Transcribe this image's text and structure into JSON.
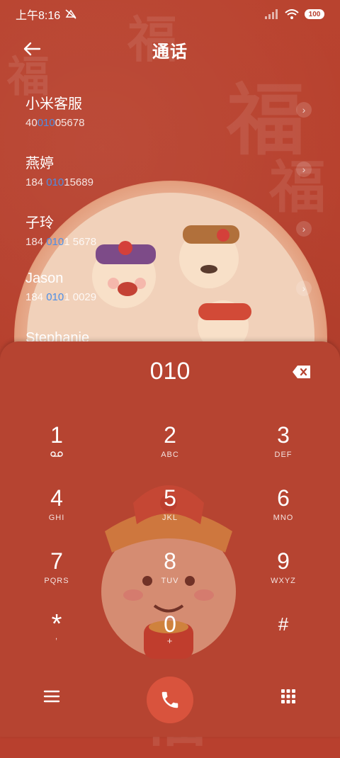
{
  "status_bar": {
    "time": "上午8:16",
    "battery": "100"
  },
  "header": {
    "title": "通话"
  },
  "contacts": [
    {
      "name": "小米客服",
      "num_pre": "40",
      "num_hl": "010",
      "num_post": "05678"
    },
    {
      "name": "燕婷",
      "num_pre": "184 ",
      "num_hl": "010",
      "num_post": "15689"
    },
    {
      "name": "子玲",
      "num_pre": "184 ",
      "num_hl": "010",
      "num_post": "1 5678"
    },
    {
      "name": "Jason",
      "num_pre": "184 ",
      "num_hl": "010",
      "num_post": "1 0029"
    },
    {
      "name": "Stephanie",
      "num_pre": "",
      "num_hl": "",
      "num_post": ""
    }
  ],
  "dialer": {
    "input": "010",
    "keys": [
      {
        "digit": "1",
        "sub": ""
      },
      {
        "digit": "2",
        "sub": "ABC"
      },
      {
        "digit": "3",
        "sub": "DEF"
      },
      {
        "digit": "4",
        "sub": "GHI"
      },
      {
        "digit": "5",
        "sub": "JKL"
      },
      {
        "digit": "6",
        "sub": "MNO"
      },
      {
        "digit": "7",
        "sub": "PQRS"
      },
      {
        "digit": "8",
        "sub": "TUV"
      },
      {
        "digit": "9",
        "sub": "WXYZ"
      },
      {
        "digit": "*",
        "sub": ","
      },
      {
        "digit": "0",
        "sub": "+"
      },
      {
        "digit": "#",
        "sub": ""
      }
    ]
  },
  "decor": {
    "fu_char": "福"
  },
  "colors": {
    "background": "#b8402e",
    "highlight": "#4d8fe6",
    "call_button": "#d9533d"
  },
  "icons": [
    "back-arrow-icon",
    "chevron-right-icon",
    "backspace-icon",
    "voicemail-icon",
    "menu-icon",
    "phone-icon",
    "dialpad-icon",
    "mute-icon",
    "signal-icon",
    "wifi-icon",
    "battery-icon"
  ]
}
